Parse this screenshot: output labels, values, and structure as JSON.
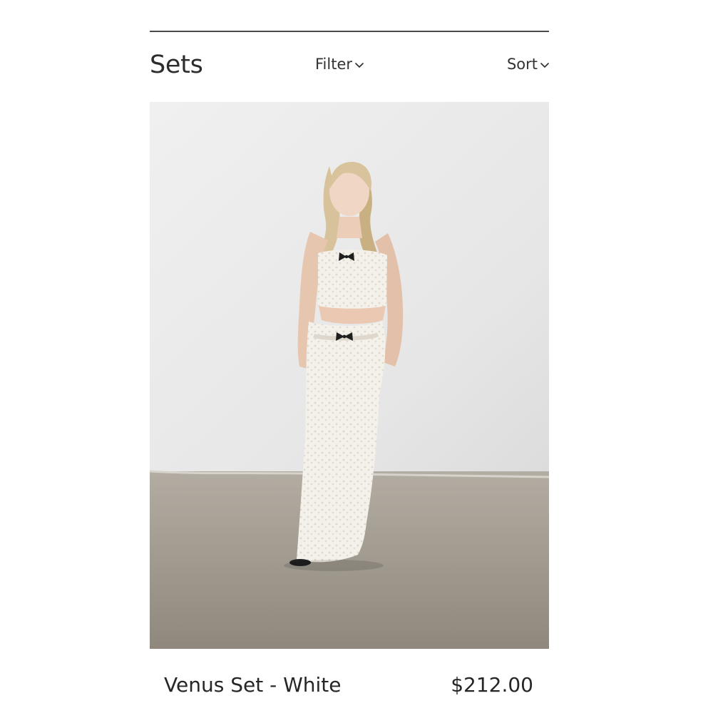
{
  "header": {
    "title": "Sets",
    "filter_label": "Filter",
    "sort_label": "Sort",
    "chevron_icon": "chevron-down-icon"
  },
  "product": {
    "name": "Venus Set - White",
    "price": "$212.00",
    "image_icon": "product-photo"
  },
  "colors": {
    "rule": "#4a4a4a",
    "text": "#2c2c2c",
    "wall": "#e9e9e9",
    "floor": "#9a948a",
    "outfit": "#f4f1ea",
    "bow": "#1f1f1f"
  }
}
